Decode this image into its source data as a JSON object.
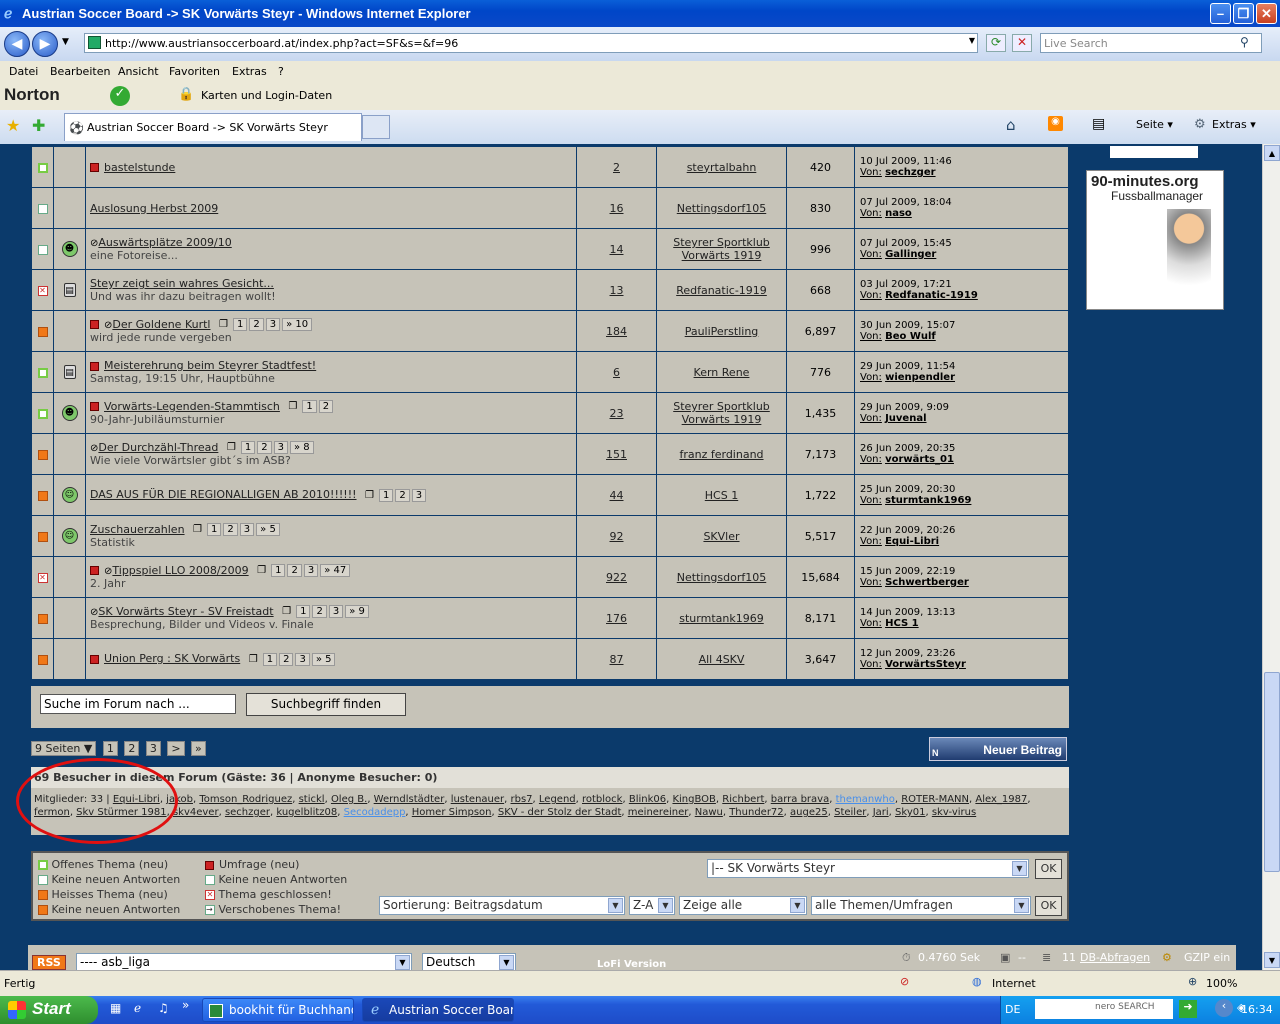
{
  "window": {
    "title": "Austrian Soccer Board -> SK Vorwärts Steyr - Windows Internet Explorer"
  },
  "browser": {
    "url": "http://www.austriansoccerboard.at/index.php?act=SF&s=&f=96",
    "search_placeholder": "Live Search",
    "menu": [
      "Datei",
      "Bearbeiten",
      "Ansicht",
      "Favoriten",
      "Extras",
      "?"
    ],
    "norton_label": "Norton",
    "cards_label": "Karten und Login-Daten",
    "tab_title": "Austrian Soccer Board -> SK Vorwärts Steyr",
    "tools": {
      "page": "Seite",
      "extras": "Extras"
    }
  },
  "topics": [
    {
      "status": "green",
      "icon": "",
      "flag": true,
      "poll": false,
      "title": "bastelstunde",
      "sub": "",
      "pages": [],
      "replies": "2",
      "author": "steyrtalbahn",
      "views": "420",
      "date": "10 Jul 2009, 11:46",
      "von_label": "Von:",
      "by": "sechzger"
    },
    {
      "status": "white",
      "icon": "",
      "flag": false,
      "poll": false,
      "title": "Auslosung Herbst 2009",
      "sub": "",
      "pages": [],
      "replies": "16",
      "author": "Nettingsdorf105",
      "views": "830",
      "date": "07 Jul 2009, 18:04",
      "von_label": "Von:",
      "by": "naso"
    },
    {
      "status": "white",
      "icon": "grin",
      "flag": false,
      "poll": true,
      "title": "Auswärtsplätze 2009/10",
      "sub": "eine Fotoreise...",
      "pages": [],
      "replies": "14",
      "author": "Steyrer Sportklub Vorwärts 1919",
      "views": "996",
      "date": "07 Jul 2009, 15:45",
      "von_label": "Von:",
      "by": "Gallinger"
    },
    {
      "status": "x",
      "icon": "doc",
      "flag": false,
      "poll": false,
      "title": "Steyr zeigt sein wahres Gesicht...",
      "sub": "Und was ihr dazu beitragen wollt!",
      "pages": [],
      "replies": "13",
      "author": "Redfanatic-1919",
      "views": "668",
      "date": "03 Jul 2009, 17:21",
      "von_label": "Von:",
      "by": "Redfanatic-1919"
    },
    {
      "status": "orange",
      "icon": "",
      "flag": true,
      "poll": true,
      "title": "Der Goldene Kurtl",
      "sub": "wird jede runde vergeben",
      "pages": [
        "1",
        "2",
        "3",
        "» 10"
      ],
      "replies": "184",
      "author": "PauliPerstling",
      "views": "6,897",
      "date": "30 Jun 2009, 15:07",
      "von_label": "Von:",
      "by": "Beo Wulf"
    },
    {
      "status": "green",
      "icon": "doc",
      "flag": true,
      "poll": false,
      "title": "Meisterehrung beim Steyrer Stadtfest!",
      "sub": "Samstag, 19:15 Uhr, Hauptbühne",
      "pages": [],
      "replies": "6",
      "author": "Kern Rene",
      "views": "776",
      "date": "29 Jun 2009, 11:54",
      "von_label": "Von:",
      "by": "wienpendler"
    },
    {
      "status": "green",
      "icon": "grin",
      "flag": true,
      "poll": false,
      "title": "Vorwärts-Legenden-Stammtisch",
      "sub": "90-Jahr-Jubiläumsturnier",
      "pages": [
        "1",
        "2"
      ],
      "replies": "23",
      "author": "Steyrer Sportklub Vorwärts 1919",
      "views": "1,435",
      "date": "29 Jun 2009, 9:09",
      "von_label": "Von:",
      "by": "Juvenal"
    },
    {
      "status": "orange",
      "icon": "",
      "flag": false,
      "poll": true,
      "title": "Der Durchzähl-Thread",
      "sub": "Wie viele Vorwärtsler gibt´s im ASB?",
      "pages": [
        "1",
        "2",
        "3",
        "» 8"
      ],
      "replies": "151",
      "author": "franz ferdinand",
      "views": "7,173",
      "date": "26 Jun 2009, 20:35",
      "von_label": "Von:",
      "by": "vorwärts_01"
    },
    {
      "status": "orange",
      "icon": "smile",
      "flag": false,
      "poll": false,
      "title": "DAS AUS FÜR DIE REGIONALLIGEN AB 2010!!!!!!",
      "sub": "",
      "pages": [
        "1",
        "2",
        "3"
      ],
      "replies": "44",
      "author": "HCS 1",
      "views": "1,722",
      "date": "25 Jun 2009, 20:30",
      "von_label": "Von:",
      "by": "sturmtank1969"
    },
    {
      "status": "orange",
      "icon": "laugh",
      "flag": false,
      "poll": false,
      "title": "Zuschauerzahlen",
      "sub": "Statistik",
      "pages": [
        "1",
        "2",
        "3",
        "» 5"
      ],
      "replies": "92",
      "author": "SKVler",
      "views": "5,517",
      "date": "22 Jun 2009, 20:26",
      "von_label": "Von:",
      "by": "Equi-Libri"
    },
    {
      "status": "x",
      "icon": "",
      "flag": true,
      "poll": true,
      "title": "Tippspiel LLO 2008/2009",
      "sub": "2. Jahr",
      "pages": [
        "1",
        "2",
        "3",
        "» 47"
      ],
      "replies": "922",
      "author": "Nettingsdorf105",
      "views": "15,684",
      "date": "15 Jun 2009, 22:19",
      "von_label": "Von:",
      "by": "Schwertberger"
    },
    {
      "status": "orange",
      "icon": "",
      "flag": false,
      "poll": true,
      "title": "SK Vorwärts Steyr - SV Freistadt",
      "sub": "Besprechung, Bilder und Videos v. Finale",
      "pages": [
        "1",
        "2",
        "3",
        "» 9"
      ],
      "replies": "176",
      "author": "sturmtank1969",
      "views": "8,171",
      "date": "14 Jun 2009, 13:13",
      "von_label": "Von:",
      "by": "HCS 1"
    },
    {
      "status": "orange",
      "icon": "",
      "flag": true,
      "poll": false,
      "title": "Union Perg : SK Vorwärts",
      "sub": "",
      "pages": [
        "1",
        "2",
        "3",
        "» 5"
      ],
      "replies": "87",
      "author": "All 4SKV",
      "views": "3,647",
      "date": "12 Jun 2009, 23:26",
      "von_label": "Von:",
      "by": "VorwärtsSteyr"
    }
  ],
  "forum_search": {
    "placeholder": "Suche im Forum nach ...",
    "button": "Suchbegriff finden"
  },
  "pager": {
    "label": "9 Seiten ▼",
    "pages": [
      "1",
      "2",
      "3",
      ">",
      "»"
    ]
  },
  "new_post": "Neuer Beitrag",
  "visitors": {
    "header": "69 Besucher in diesem Forum (Gäste: 36 | Anonyme Besucher: 0)",
    "members_label": "Mitglieder: 33 |",
    "members": [
      "Equi-Libri",
      "jakob",
      "Tomson_Rodriguez",
      "stickl",
      "Oleg B.",
      "Werndlstädter",
      "lustenauer",
      "rbs7",
      "Legend",
      "rotblock",
      "Blink06",
      "KingBOB",
      "Richbert",
      "barra brava",
      "themanwho",
      "ROTER-MANN",
      "Alex_1987",
      "fermon",
      "Skv Stürmer 1981",
      "skv4ever",
      "sechzger",
      "kugelblitz08",
      "Secodadepp",
      "Homer Simpson",
      "SKV - der Stolz der Stadt",
      "meinereiner",
      "Nawu",
      "Thunder72",
      "auge25",
      "Steiler",
      "Jari",
      "Sky01",
      "skv-virus"
    ]
  },
  "legend": [
    "Offenes Thema (neu)",
    "Keine neuen Antworten",
    "Heisses Thema (neu)",
    "Keine neuen Antworten",
    "Umfrage (neu)",
    "Keine neuen Antworten",
    "Thema geschlossen!",
    "Verschobenes Thema!"
  ],
  "forum_jump": {
    "selected": "|-- SK Vorwärts Steyr",
    "ok": "OK"
  },
  "sort": {
    "by": "Sortierung: Beitragsdatum",
    "order": "Z-A",
    "show": "Zeige alle",
    "filter": "alle Themen/Umfragen",
    "ok": "OK"
  },
  "footer": {
    "rss": "RSS",
    "skin": "---- asb_liga",
    "lang": "Deutsch",
    "lofi": "LoFi Version",
    "time": "0.4760 Sek",
    "sep": "--",
    "db": "11",
    "db_label": "DB-Abfragen",
    "gzip": "GZIP ein"
  },
  "ad": {
    "brand": "90-minutes.org",
    "subtitle": "Fussballmanager"
  },
  "status": {
    "text": "Fertig",
    "zone": "Internet",
    "zoom": "100%"
  },
  "taskbar": {
    "start": "Start",
    "tasks": [
      "bookhit für Buchhandl...",
      "Austrian Soccer Boar..."
    ],
    "lang": "DE",
    "time": "16:34",
    "nero": "nero SEARCH"
  },
  "colors": {
    "forum_bg": "#0b3a6b",
    "row_bg": "#c6c3b8",
    "hot": "#f07818",
    "xp_blue": "#225ad8"
  }
}
